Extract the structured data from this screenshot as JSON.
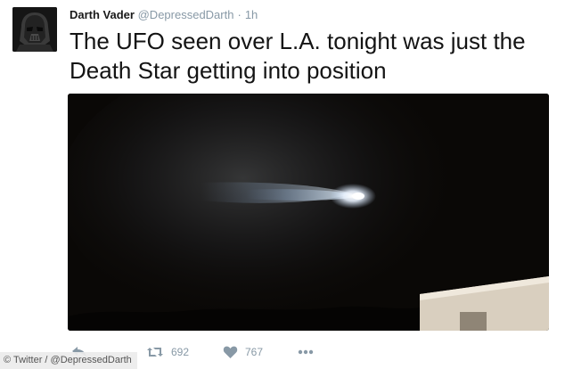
{
  "tweet": {
    "author_name": "Darth Vader",
    "author_handle": "@DepressedDarth",
    "separator": "·",
    "time": "1h",
    "text": "The UFO seen over L.A. tonight was just the Death Star getting into position",
    "media_icon": "photo-night-sky-light-streak",
    "actions": {
      "reply_icon": "reply-icon",
      "retweet_icon": "retweet-icon",
      "retweet_count": "692",
      "like_icon": "heart-icon",
      "like_count": "767",
      "more_icon": "more-icon"
    }
  },
  "credit": "© Twitter / @DepressedDarth",
  "colors": {
    "meta_gray": "#8899a6",
    "text": "#141414",
    "media_background": "#0a0806"
  }
}
